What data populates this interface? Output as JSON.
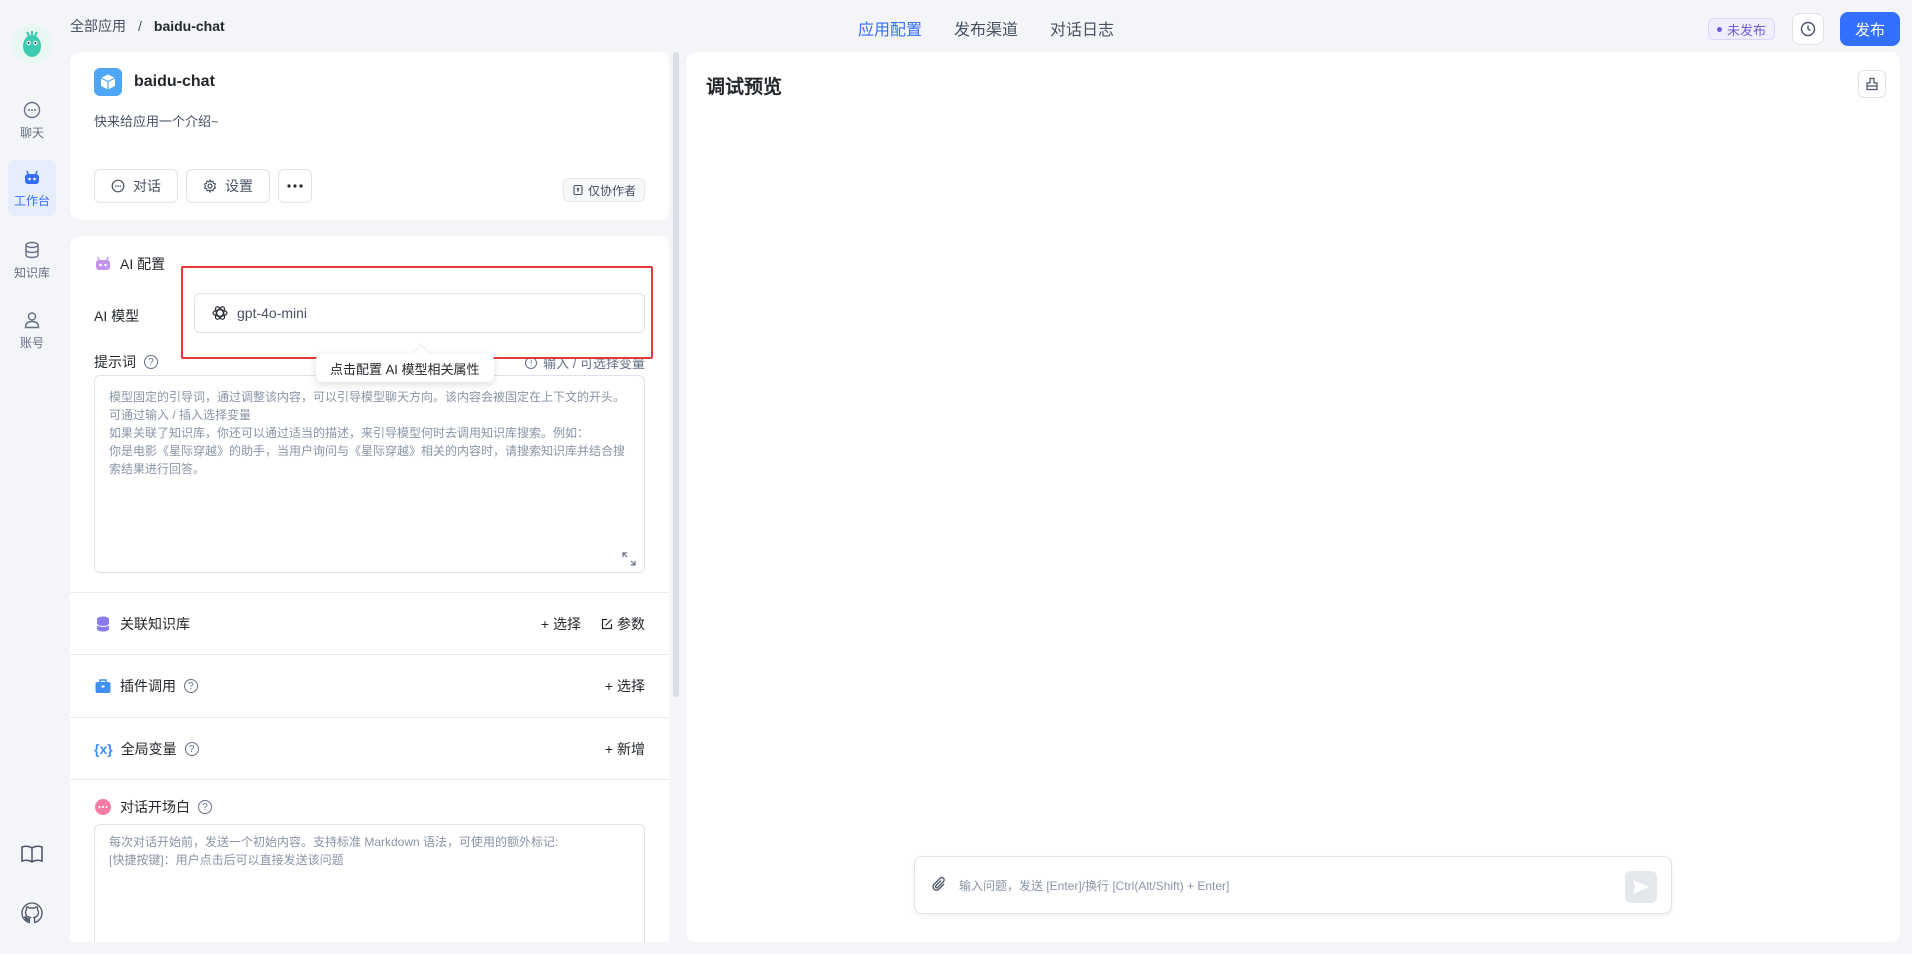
{
  "breadcrumb": {
    "root": "全部应用",
    "separator": "/",
    "current": "baidu-chat"
  },
  "topnav": {
    "tabs": [
      "应用配置",
      "发布渠道",
      "对话日志"
    ]
  },
  "status": {
    "label": "未发布"
  },
  "publish": {
    "label": "发布"
  },
  "sidebar": {
    "items": [
      {
        "label": "聊天",
        "icon": "chat-icon"
      },
      {
        "label": "工作台",
        "icon": "robot-icon"
      },
      {
        "label": "知识库",
        "icon": "database-icon"
      },
      {
        "label": "账号",
        "icon": "user-icon"
      }
    ]
  },
  "app": {
    "name": "baidu-chat",
    "intro": "快来给应用一个介绍~",
    "chat_label": "对话",
    "settings_label": "设置",
    "collab_label": "仅协作者"
  },
  "ai_config": {
    "title": "AI 配置",
    "model_label": "AI 模型",
    "model_value": "gpt-4o-mini",
    "tooltip": "点击配置 AI 模型相关属性"
  },
  "prompt": {
    "title": "提示词",
    "var_hint": "输入 / 可选择变量",
    "placeholder": "模型固定的引导词，通过调整该内容，可以引导模型聊天方向。该内容会被固定在上下文的开头。\n可通过输入 / 插入选择变量\n如果关联了知识库，你还可以通过适当的描述，来引导模型何时去调用知识库搜索。例如：\n你是电影《星际穿越》的助手，当用户询问与《星际穿越》相关的内容时，请搜索知识库并结合搜\n索结果进行回答。"
  },
  "dataset": {
    "title": "关联知识库",
    "select_label": "选择",
    "params_label": "参数"
  },
  "plugins": {
    "title": "插件调用",
    "select_label": "选择"
  },
  "variables": {
    "title": "全局变量",
    "add_label": "新增"
  },
  "opener": {
    "title": "对话开场白",
    "placeholder": "每次对话开始前，发送一个初始内容。支持标准 Markdown 语法，可使用的额外标记:\n[快捷按键]：用户点击后可以直接发送该问题"
  },
  "preview": {
    "title": "调试预览",
    "input_placeholder": "输入问题，发送 [Enter]/换行 [Ctrl(Alt/Shift) + Enter]"
  },
  "colors": {
    "accent": "#3370ff",
    "highlight": "#e53935"
  }
}
